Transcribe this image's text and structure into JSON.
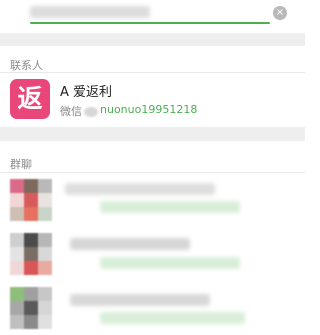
{
  "search": {
    "clear_icon": "close-icon",
    "clear_glyph": "×"
  },
  "contacts": {
    "title": "联系人",
    "item": {
      "icon_name": "fanli-app-icon",
      "icon_text": "返",
      "name": "A  爱返利",
      "meta_label": "微信",
      "id": "nuonuo19951218"
    }
  },
  "groups": {
    "title": "群聊",
    "items": [
      {
        "text": ""
      },
      {
        "text": ""
      },
      {
        "text": ""
      }
    ]
  },
  "colors": {
    "accent_green": "#4caf50",
    "icon_pink": "#e94779"
  }
}
